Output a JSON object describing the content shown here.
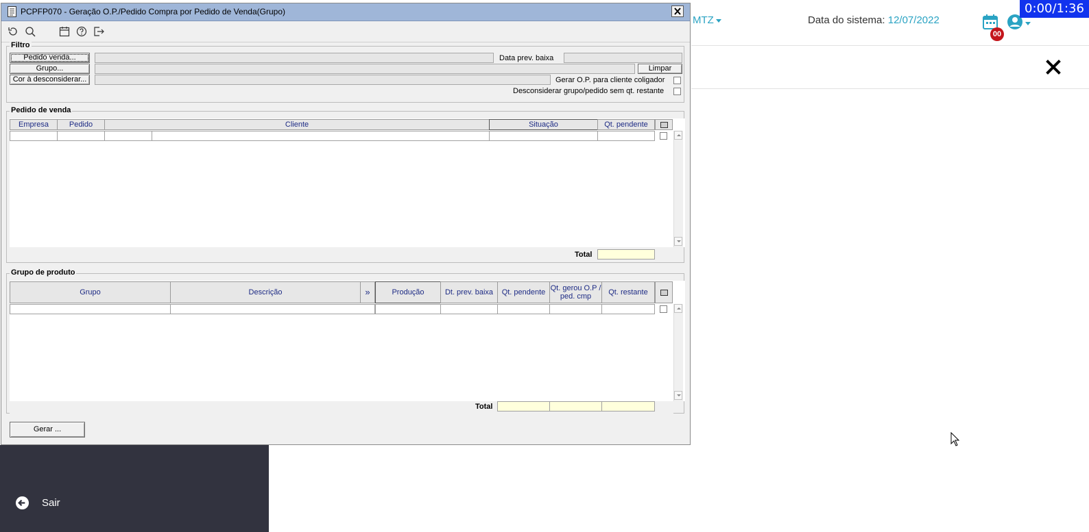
{
  "window": {
    "title": "PCPFP070 - Geração O.P./Pedido Compra por Pedido de Venda(Grupo)",
    "close_label": "×"
  },
  "toolbar": {
    "icons": [
      "refresh-icon",
      "search-icon",
      "calendar-icon",
      "help-icon",
      "exit-icon"
    ]
  },
  "filtro": {
    "legend": "Filtro",
    "pedido_venda_btn": "Pedido venda...",
    "grupo_btn": "Grupo...",
    "cor_btn": "Cor à desconsiderar...",
    "data_prev_baixa_label": "Data prev. baixa",
    "limpar_btn": "Limpar",
    "gerar_op_label": "Gerar O.P. para cliente coligador",
    "desconsiderar_label": "Desconsiderar grupo/pedido sem qt. restante"
  },
  "pedido_venda": {
    "legend": "Pedido de venda",
    "columns": [
      "Empresa",
      "Pedido",
      "Cliente",
      "Situação",
      "Qt. pendente"
    ],
    "total_label": "Total"
  },
  "grupo_produto": {
    "legend": "Grupo de produto",
    "columns": [
      "Grupo",
      "Descrição",
      "»",
      "Produção",
      "Dt. prev. baixa",
      "Qt. pendente",
      "Qt. gerou O.P / ped. cmp",
      "Qt. restante"
    ],
    "total_label": "Total"
  },
  "gerar_btn": "Gerar ...",
  "app": {
    "company": "MTZ",
    "system_date_label": "Data do sistema:",
    "system_date_value": "12/07/2022",
    "notification_count": "00",
    "timer": "0:00/1:36",
    "sair_label": "Sair",
    "accent_color": "#2aa3c3",
    "sidebar_color": "#32333f"
  }
}
